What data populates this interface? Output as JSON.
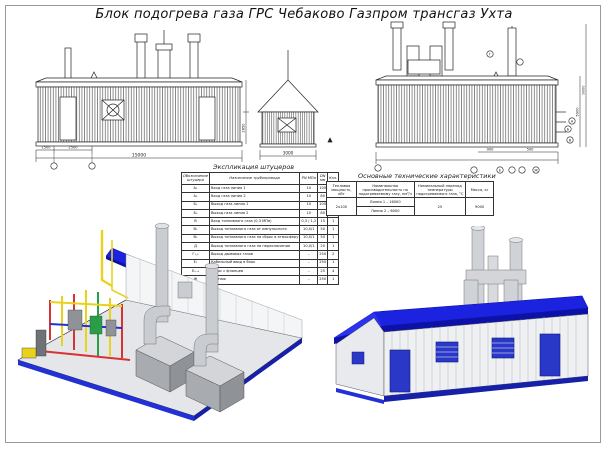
{
  "sheet": {
    "title": "Блок подогрева газа ГРС Чебаково Газпром трансгаз Ухта"
  },
  "spec_table": {
    "caption": "Экспликация штуцеров",
    "headers": [
      "Обозначение штуцера",
      "Назначение трубопровода",
      "PN МПа",
      "DN мм",
      "Кол."
    ],
    "rows": [
      [
        "А₁",
        "Вход газа линия 1",
        "10",
        "100",
        "1"
      ],
      [
        "А₂",
        "Вход газа линия 2",
        "10",
        "80",
        "1"
      ],
      [
        "Б₁",
        "Выход газа линия 1",
        "10",
        "100",
        "1"
      ],
      [
        "Б₂",
        "Выход газа линия 2",
        "10",
        "80",
        "1"
      ],
      [
        "В",
        "Вход топливного газа (0,3 МПа)",
        "0,3 / 1,2",
        "15",
        "1"
      ],
      [
        "В₁",
        "Выход топливного газа от импульсного",
        "10,0/1",
        "50",
        "1"
      ],
      [
        "В₂",
        "Выход топливного газа на сброс в атмосферу",
        "10,0/1",
        "50",
        "1"
      ],
      [
        "Д",
        "Выход топливного газа на переключение",
        "10,0/1",
        "20",
        "1"
      ],
      [
        "Г₁,₂",
        "Выход дымовых газов",
        "–",
        "250",
        "2"
      ],
      [
        "Е₁",
        "Кабельный ввод в блок",
        "–",
        "250",
        "1"
      ],
      [
        "Е₂₋₄",
        "Сброс с фланцев",
        "–",
        "25",
        "4"
      ],
      [
        "Ж",
        "Дренаж",
        "–",
        "250",
        "1"
      ]
    ]
  },
  "tech_table": {
    "caption": "Основные технические характеристики",
    "headers": [
      "Тепловая мощность, кВт",
      "Номинальная производительность по подогреваемому газу, нм³/ч",
      "Номинальный перепад температуры подогреваемого газа, °С",
      "Масса, кг"
    ],
    "power": "2x100",
    "flow": [
      "Линия 1 – 16000",
      "Линия 2 – 6000"
    ],
    "delta_t": "25",
    "mass": "9000"
  },
  "dimensions": {
    "front_length": "15000",
    "front_sub1": "1500",
    "front_sub2": "2500",
    "end_width": "3000",
    "height_roof": "2850",
    "height_total": "9000",
    "chimney_height": "5900",
    "rear_width": "15000",
    "rear_sub1": "900",
    "rear_sub2": "500"
  },
  "callouts": {
    "gas_in": "А",
    "gas_out": "Б",
    "fuel": "В",
    "smoke": "Г",
    "cable": "Е",
    "drain": "Ж"
  },
  "colors": {
    "roof_blue": "#1c23e0",
    "roof_dark": "#0c11a8",
    "wall": "#eef0f2",
    "wall_rib": "#b9bec5",
    "door_blue": "#2a38c8",
    "chimney": "#c9ccd1",
    "pipe_yellow": "#e9d21d",
    "pipe_red": "#d83232",
    "frame_blue": "#2230d6",
    "equipment_green": "#2a9c4a",
    "grey_heater": "#a8abb0"
  }
}
